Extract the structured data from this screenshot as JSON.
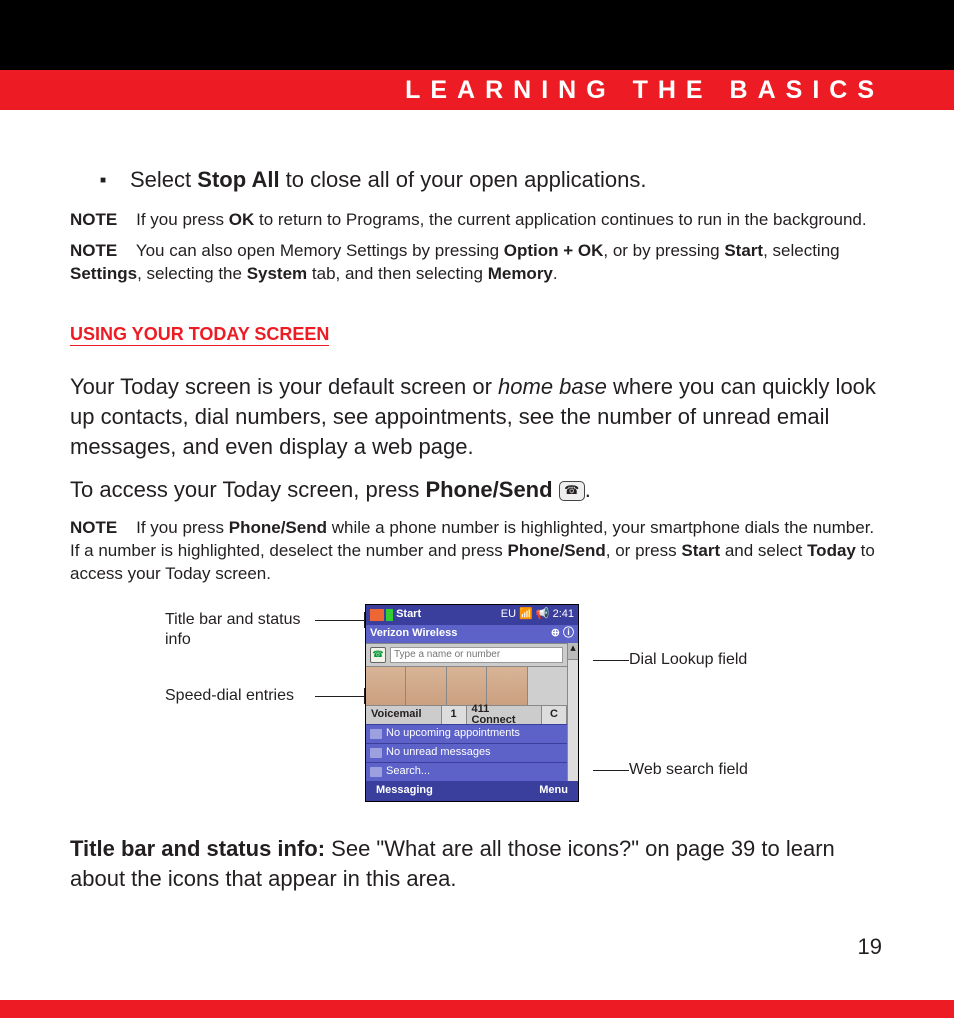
{
  "header": {
    "chapter_title": "LEARNING THE BASICS"
  },
  "bullets": {
    "stop_all": {
      "pre": "Select ",
      "bold": "Stop All",
      "post": " to close all of your open applications."
    }
  },
  "notes": {
    "note_label": "NOTE",
    "n1": {
      "pre": "If you press ",
      "b1": "OK",
      "post": " to return to Programs, the current application continues to run in the background."
    },
    "n2": {
      "pre": "You can also open Memory Settings by pressing ",
      "b1": "Option + OK",
      "mid1": ", or by pressing ",
      "b2": "Start",
      "mid2": ", selecting ",
      "b3": "Settings",
      "mid3": ", selecting the ",
      "b4": "System",
      "mid4": " tab, and then selecting ",
      "b5": "Memory",
      "post": "."
    },
    "n3": {
      "pre": "If you press ",
      "b1": "Phone/Send",
      "mid1": " while a phone number is highlighted, your smartphone dials the number. If a number is highlighted, deselect the number and press ",
      "b2": "Phone/Send",
      "mid2": ", or press ",
      "b3": "Start",
      "mid3": " and select ",
      "b4": "Today",
      "post": " to access your Today screen."
    }
  },
  "section": {
    "title": "USING YOUR TODAY SCREEN"
  },
  "paras": {
    "p1": {
      "pre": "Your Today screen is your default screen or ",
      "ital": "home base",
      "post": " where you can quickly look up contacts, dial numbers, see appointments, see the number of unread email messages, and even display a web page."
    },
    "p2": {
      "pre": "To access your Today screen, press ",
      "bold": "Phone/Send",
      "post": "."
    },
    "p3": {
      "bold": "Title bar and status info:",
      "post": " See \"What are all those icons?\" on page 39 to learn about the icons that appear in this area."
    }
  },
  "callouts": {
    "left1": "Title bar and status info",
    "left2": "Speed-dial entries",
    "right1": "Dial Lookup field",
    "right2": "Web search field"
  },
  "phone": {
    "start": "Start",
    "status_icons": "EU  📶 📢 2:41",
    "operator": "Verizon Wireless",
    "dial_placeholder": "Type a name or number",
    "speed_dial": [
      {
        "label": "Voicemail",
        "key": "1"
      },
      {
        "label": "411 Connect",
        "key": "C"
      }
    ],
    "line_appts": "No upcoming appointments",
    "line_msgs": "No unread messages",
    "line_search": "Search...",
    "soft_left": "Messaging",
    "soft_right": "Menu"
  },
  "page_number": "19"
}
